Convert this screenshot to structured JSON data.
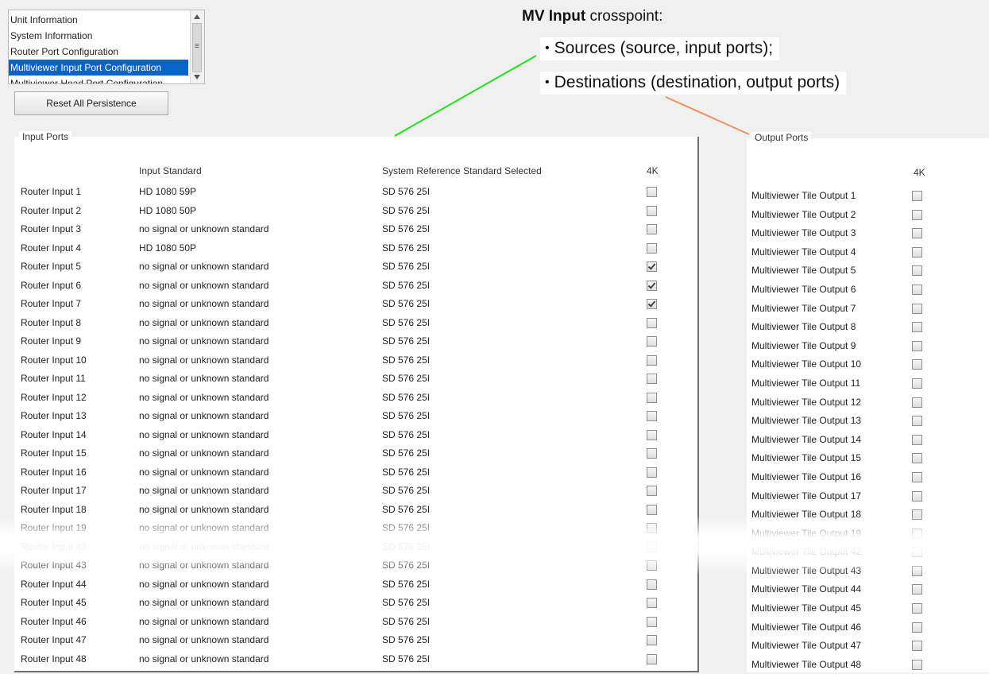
{
  "nav": {
    "items": [
      {
        "label": "Unit Information",
        "selected": false
      },
      {
        "label": "System Information",
        "selected": false
      },
      {
        "label": "Router Port Configuration",
        "selected": false
      },
      {
        "label": "Multiviewer Input Port Configuration",
        "selected": true
      },
      {
        "label": "Multiviewer Head Port Configuration",
        "selected": false
      }
    ],
    "scroll_icon": "scrollbar-grip-icon"
  },
  "reset_button": "Reset All Persistence",
  "callout": {
    "title_bold": "MV Input",
    "title_rest": " crosspoint:",
    "bullets": [
      "Sources (source, input ports);",
      "Destinations (destination, output ports)"
    ],
    "colors": {
      "sources_line": "#22e01e",
      "destinations_line": "#f0915a"
    }
  },
  "input_panel": {
    "title": "Input Ports",
    "headers": {
      "standard": "Input Standard",
      "reference": "System Reference Standard Selected",
      "fourk": "4K"
    },
    "rows": [
      {
        "name": "Router Input 1",
        "standard": "HD 1080 59P",
        "reference": "SD 576 25I",
        "fourk": false
      },
      {
        "name": "Router Input 2",
        "standard": "HD 1080 50P",
        "reference": "SD 576 25I",
        "fourk": false
      },
      {
        "name": "Router Input 3",
        "standard": "no signal or unknown standard",
        "reference": "SD 576 25I",
        "fourk": false
      },
      {
        "name": "Router Input 4",
        "standard": "HD 1080 50P",
        "reference": "SD 576 25I",
        "fourk": false
      },
      {
        "name": "Router Input 5",
        "standard": "no signal or unknown standard",
        "reference": "SD 576 25I",
        "fourk": true
      },
      {
        "name": "Router Input 6",
        "standard": "no signal or unknown standard",
        "reference": "SD 576 25I",
        "fourk": true
      },
      {
        "name": "Router Input 7",
        "standard": "no signal or unknown standard",
        "reference": "SD 576 25I",
        "fourk": true
      },
      {
        "name": "Router Input 8",
        "standard": "no signal or unknown standard",
        "reference": "SD 576 25I",
        "fourk": false
      },
      {
        "name": "Router Input 9",
        "standard": "no signal or unknown standard",
        "reference": "SD 576 25I",
        "fourk": false
      },
      {
        "name": "Router Input 10",
        "standard": "no signal or unknown standard",
        "reference": "SD 576 25I",
        "fourk": false
      },
      {
        "name": "Router Input 11",
        "standard": "no signal or unknown standard",
        "reference": "SD 576 25I",
        "fourk": false
      },
      {
        "name": "Router Input 12",
        "standard": "no signal or unknown standard",
        "reference": "SD 576 25I",
        "fourk": false
      },
      {
        "name": "Router Input 13",
        "standard": "no signal or unknown standard",
        "reference": "SD 576 25I",
        "fourk": false
      },
      {
        "name": "Router Input 14",
        "standard": "no signal or unknown standard",
        "reference": "SD 576 25I",
        "fourk": false
      },
      {
        "name": "Router Input 15",
        "standard": "no signal or unknown standard",
        "reference": "SD 576 25I",
        "fourk": false
      },
      {
        "name": "Router Input 16",
        "standard": "no signal or unknown standard",
        "reference": "SD 576 25I",
        "fourk": false
      },
      {
        "name": "Router Input 17",
        "standard": "no signal or unknown standard",
        "reference": "SD 576 25I",
        "fourk": false
      },
      {
        "name": "Router Input 18",
        "standard": "no signal or unknown standard",
        "reference": "SD 576 25I",
        "fourk": false
      },
      {
        "name": "Router Input 19",
        "standard": "no signal or unknown standard",
        "reference": "SD 576 25I",
        "fourk": false
      },
      {
        "name": "Router Input 42",
        "standard": "no signal or unknown standard",
        "reference": "SD 576 25I",
        "fourk": false
      },
      {
        "name": "Router Input 43",
        "standard": "no signal or unknown standard",
        "reference": "SD 576 25I",
        "fourk": false
      },
      {
        "name": "Router Input 44",
        "standard": "no signal or unknown standard",
        "reference": "SD 576 25I",
        "fourk": false
      },
      {
        "name": "Router Input 45",
        "standard": "no signal or unknown standard",
        "reference": "SD 576 25I",
        "fourk": false
      },
      {
        "name": "Router Input 46",
        "standard": "no signal or unknown standard",
        "reference": "SD 576 25I",
        "fourk": false
      },
      {
        "name": "Router Input 47",
        "standard": "no signal or unknown standard",
        "reference": "SD 576 25I",
        "fourk": false
      },
      {
        "name": "Router Input 48",
        "standard": "no signal or unknown standard",
        "reference": "SD 576 25I",
        "fourk": false
      }
    ]
  },
  "output_panel": {
    "title": "Output Ports",
    "headers": {
      "fourk": "4K"
    },
    "rows": [
      {
        "name": "Multiviewer Tile Output 1",
        "fourk": false
      },
      {
        "name": "Multiviewer Tile Output 2",
        "fourk": false
      },
      {
        "name": "Multiviewer Tile Output 3",
        "fourk": false
      },
      {
        "name": "Multiviewer Tile Output 4",
        "fourk": false
      },
      {
        "name": "Multiviewer Tile Output 5",
        "fourk": false
      },
      {
        "name": "Multiviewer Tile Output 6",
        "fourk": false
      },
      {
        "name": "Multiviewer Tile Output 7",
        "fourk": false
      },
      {
        "name": "Multiviewer Tile Output 8",
        "fourk": false
      },
      {
        "name": "Multiviewer Tile Output 9",
        "fourk": false
      },
      {
        "name": "Multiviewer Tile Output 10",
        "fourk": false
      },
      {
        "name": "Multiviewer Tile Output 11",
        "fourk": false
      },
      {
        "name": "Multiviewer Tile Output 12",
        "fourk": false
      },
      {
        "name": "Multiviewer Tile Output 13",
        "fourk": false
      },
      {
        "name": "Multiviewer Tile Output 14",
        "fourk": false
      },
      {
        "name": "Multiviewer Tile Output 15",
        "fourk": false
      },
      {
        "name": "Multiviewer Tile Output 16",
        "fourk": false
      },
      {
        "name": "Multiviewer Tile Output 17",
        "fourk": false
      },
      {
        "name": "Multiviewer Tile Output 18",
        "fourk": false
      },
      {
        "name": "Multiviewer Tile Output 19",
        "fourk": false
      },
      {
        "name": "Multiviewer Tile Output 42",
        "fourk": false
      },
      {
        "name": "Multiviewer Tile Output 43",
        "fourk": false
      },
      {
        "name": "Multiviewer Tile Output 44",
        "fourk": false
      },
      {
        "name": "Multiviewer Tile Output 45",
        "fourk": false
      },
      {
        "name": "Multiviewer Tile Output 46",
        "fourk": false
      },
      {
        "name": "Multiviewer Tile Output 47",
        "fourk": false
      },
      {
        "name": "Multiviewer Tile Output 48",
        "fourk": false
      }
    ]
  }
}
